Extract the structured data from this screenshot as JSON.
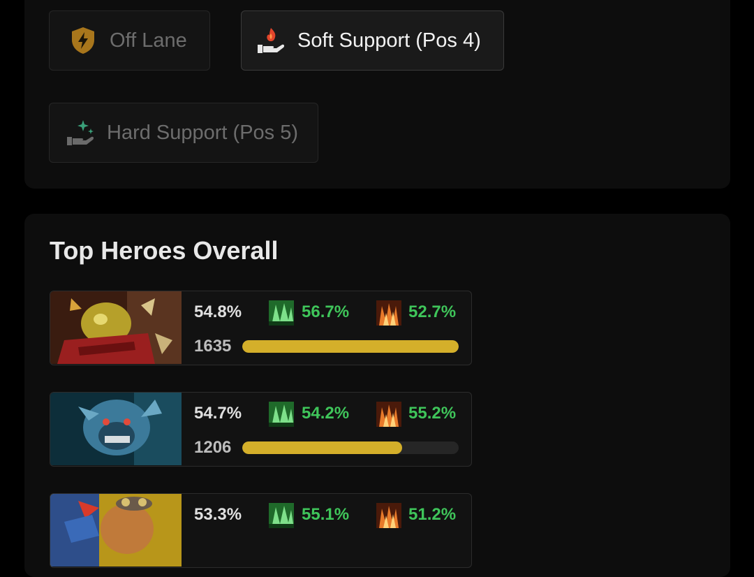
{
  "roles": [
    {
      "label": "Off Lane",
      "icon": "shield-lightning-icon",
      "active": false
    },
    {
      "label": "Soft Support (Pos 4)",
      "icon": "hand-flame-icon",
      "active": true
    },
    {
      "label": "Hard Support (Pos 5)",
      "icon": "hand-sparkle-icon",
      "active": false
    }
  ],
  "top_heroes": {
    "title": "Top Heroes Overall",
    "rows": [
      {
        "winrate": "54.8%",
        "radiant_winrate": "56.7%",
        "dire_winrate": "52.7%",
        "matches": "1635",
        "popularity": 1.0
      },
      {
        "winrate": "54.7%",
        "radiant_winrate": "54.2%",
        "dire_winrate": "55.2%",
        "matches": "1206",
        "popularity": 0.74
      },
      {
        "winrate": "53.3%",
        "radiant_winrate": "55.1%",
        "dire_winrate": "51.2%",
        "matches": "",
        "popularity": 0
      }
    ]
  },
  "colors": {
    "accent_green": "#3fc55a",
    "bar_gold": "#d4af2a"
  }
}
